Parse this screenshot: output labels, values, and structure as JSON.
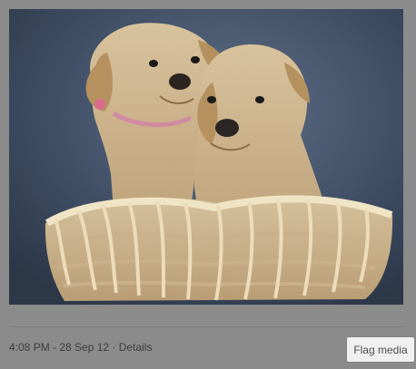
{
  "media": {
    "subject": "two puppies in basket"
  },
  "footer": {
    "timestamp": "4:08 PM - 28 Sep 12",
    "separator": "·",
    "details_label": "Details",
    "flag_label": "Flag media"
  }
}
